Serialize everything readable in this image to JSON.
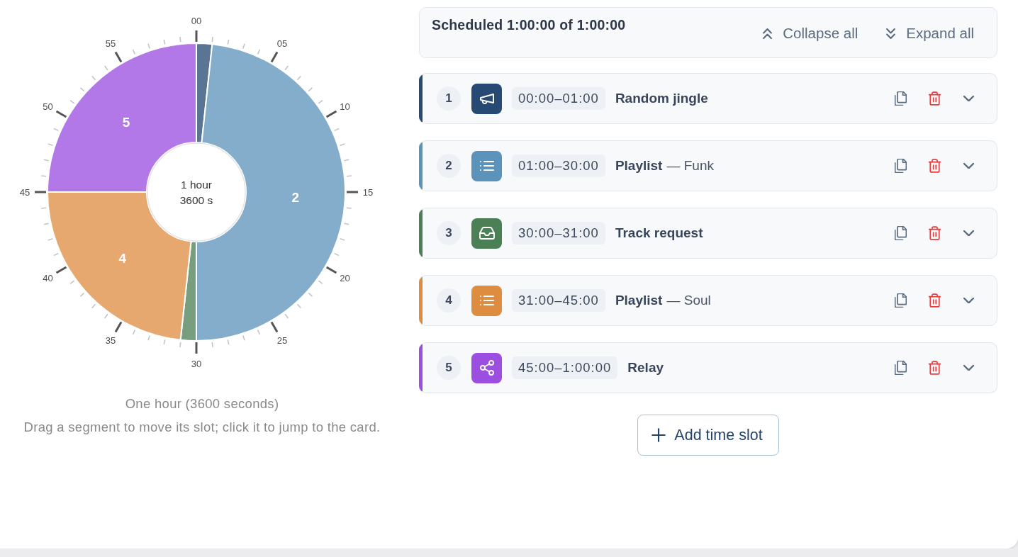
{
  "clock": {
    "dial_labels": [
      "00",
      "05",
      "10",
      "15",
      "20",
      "25",
      "30",
      "35",
      "40",
      "45",
      "50",
      "55"
    ],
    "chart_data": {
      "type": "donut",
      "categories": [
        null,
        "2",
        null,
        "4",
        "5"
      ],
      "values": [
        1.7,
        48.3,
        1.7,
        23.3,
        25
      ]
    },
    "center_lines": [
      "1 hour",
      "3600 s"
    ],
    "caption": "One hour (3600 seconds)",
    "hint": "Drag a segment to move its slot; click it to jump to the card."
  },
  "summary": {
    "title": "Scheduled 1:00:00 of 1:00:00",
    "actions": [
      {
        "kind": "collapse",
        "label": "Collapse all"
      },
      {
        "kind": "expand",
        "label": "Expand all"
      }
    ]
  },
  "slots": [
    {
      "number": "1",
      "kind": "jingle",
      "color": "#264a73",
      "time": "00:00–01:00",
      "title": "Random jingle",
      "expanded": false
    },
    {
      "number": "2",
      "kind": "playlist",
      "color": "#5c93bb",
      "time": "01:00–30:00",
      "title": "Playlist",
      "detail": "— Funk",
      "expanded": false
    },
    {
      "number": "3",
      "kind": "request",
      "color": "#4b8057",
      "time": "30:00–31:00",
      "title": "Track request",
      "expanded": false
    },
    {
      "number": "4",
      "kind": "playlist",
      "color": "#de8c40",
      "time": "31:00–45:00",
      "title": "Playlist",
      "detail": "— Soul",
      "expanded": false
    },
    {
      "number": "5",
      "kind": "relay",
      "color": "#9b4ee0",
      "time": "45:00–1:00:00",
      "title": "Relay",
      "expanded": false
    }
  ],
  "add_button": "Add time slot"
}
